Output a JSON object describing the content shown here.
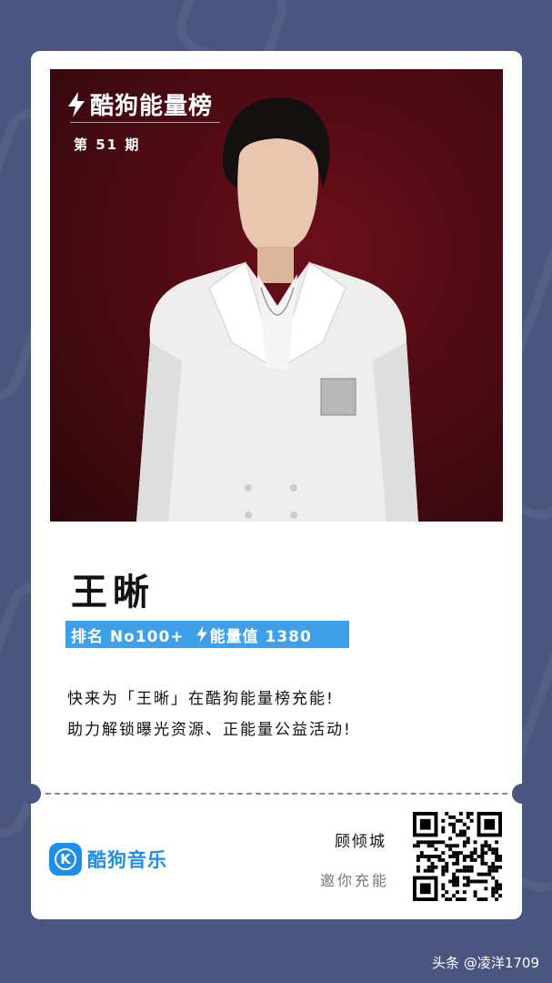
{
  "header": {
    "brand_title": "酷狗能量榜",
    "issue": "第 51 期"
  },
  "artist": {
    "name": "王晰"
  },
  "rank": {
    "rank_text": "排名 No100+",
    "energy_text": "能量值 1380"
  },
  "description": {
    "line1": "快来为「王晰」在酷狗能量榜充能!",
    "line2": "助力解锁曝光资源、正能量公益活动!"
  },
  "footer": {
    "app_name": "酷狗音乐",
    "logo_letter": "K",
    "user_name": "顾倾城",
    "invite_text": "邀你充能"
  },
  "watermark": "头条 @凌洋1709",
  "colors": {
    "background": "#4a5680",
    "rank_bar": "#3ea0ea",
    "brand_blue": "#1e8fe8",
    "photo_backdrop": "#5a0c16"
  },
  "icons": [
    "lightning-icon",
    "kugou-logo-icon",
    "qr-code"
  ]
}
